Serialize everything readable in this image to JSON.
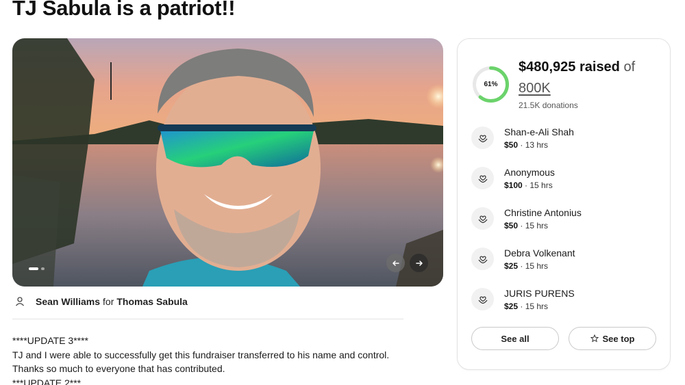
{
  "page": {
    "title": "TJ Sabula is a patriot!!"
  },
  "gallery": {
    "prev_icon": "arrow-left-icon",
    "next_icon": "arrow-right-icon"
  },
  "organizer": {
    "name": "Sean Williams",
    "for_word": "for",
    "beneficiary": "Thomas Sabula"
  },
  "story": {
    "lines": [
      "****UPDATE 3****",
      "TJ and I were able to successfully get this fundraiser transferred to his name and control.",
      "Thanks so much to everyone that has contributed.",
      "***UPDATE 2***"
    ]
  },
  "progress": {
    "percent_label": "61%",
    "percent": 0.61,
    "raised": "$480,925 raised",
    "of_word": "of",
    "goal": "800K",
    "donation_count": "21.5K donations",
    "ring_color": "#6bd36b",
    "track_color": "#e8e8e8"
  },
  "donations": [
    {
      "name": "Shan-e-Ali Shah",
      "amount": "$50",
      "time": "13 hrs"
    },
    {
      "name": "Anonymous",
      "amount": "$100",
      "time": "15 hrs"
    },
    {
      "name": "Christine Antonius",
      "amount": "$50",
      "time": "15 hrs"
    },
    {
      "name": "Debra Volkenant",
      "amount": "$25",
      "time": "15 hrs"
    },
    {
      "name": "JURIS PURENS",
      "amount": "$25",
      "time": "15 hrs"
    }
  ],
  "buttons": {
    "see_all": "See all",
    "see_top": "See top"
  },
  "separator": " · "
}
